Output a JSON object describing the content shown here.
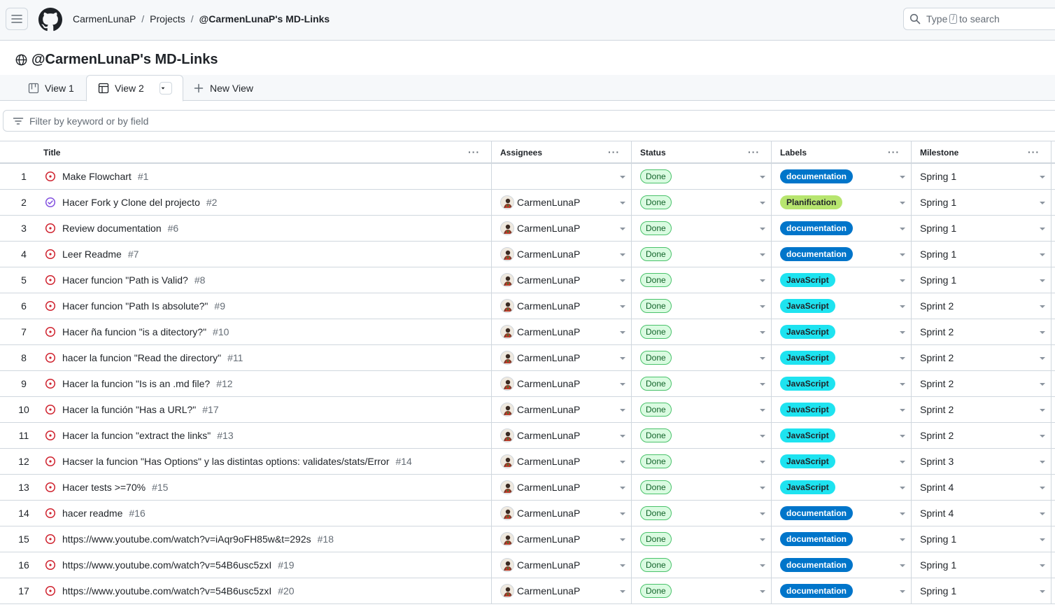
{
  "header": {
    "breadcrumbs": [
      "CarmenLunaP",
      "Projects",
      "@CarmenLunaP's MD-Links"
    ],
    "search_prefix": "Type",
    "search_key": "/",
    "search_suffix": "to search"
  },
  "project": {
    "title": "@CarmenLunaP's MD-Links",
    "tabs": [
      {
        "label": "View 1",
        "icon": "board-icon"
      },
      {
        "label": "View 2",
        "icon": "table-icon",
        "active": true
      },
      {
        "label": "New View",
        "icon": "plus-icon"
      }
    ],
    "filter_placeholder": "Filter by keyword or by field"
  },
  "table": {
    "columns": [
      "Title",
      "Assignees",
      "Status",
      "Labels",
      "Milestone"
    ],
    "rows": [
      {
        "n": "1",
        "title": "Make Flowchart",
        "num": "#1",
        "state": "open",
        "assignee": "",
        "status": "Done",
        "label": "documentation",
        "milestone": "Spring 1"
      },
      {
        "n": "2",
        "title": "Hacer Fork y Clone del projecto",
        "num": "#2",
        "state": "closed",
        "assignee": "CarmenLunaP",
        "status": "Done",
        "label": "Planification",
        "milestone": "Spring 1"
      },
      {
        "n": "3",
        "title": "Review documentation",
        "num": "#6",
        "state": "open",
        "assignee": "CarmenLunaP",
        "status": "Done",
        "label": "documentation",
        "milestone": "Spring 1"
      },
      {
        "n": "4",
        "title": "Leer Readme",
        "num": "#7",
        "state": "open",
        "assignee": "CarmenLunaP",
        "status": "Done",
        "label": "documentation",
        "milestone": "Spring 1"
      },
      {
        "n": "5",
        "title": "Hacer funcion \"Path is Valid?",
        "num": "#8",
        "state": "open",
        "assignee": "CarmenLunaP",
        "status": "Done",
        "label": "JavaScript",
        "milestone": "Spring 1"
      },
      {
        "n": "6",
        "title": "Hacer funcion \"Path Is absolute?\"",
        "num": "#9",
        "state": "open",
        "assignee": "CarmenLunaP",
        "status": "Done",
        "label": "JavaScript",
        "milestone": "Sprint 2"
      },
      {
        "n": "7",
        "title": "Hacer ña funcion \"is a ditectory?\"",
        "num": "#10",
        "state": "open",
        "assignee": "CarmenLunaP",
        "status": "Done",
        "label": "JavaScript",
        "milestone": "Sprint 2"
      },
      {
        "n": "8",
        "title": "hacer la funcion \"Read the directory\"",
        "num": "#11",
        "state": "open",
        "assignee": "CarmenLunaP",
        "status": "Done",
        "label": "JavaScript",
        "milestone": "Sprint 2"
      },
      {
        "n": "9",
        "title": "Hacer la funcion \"Is is an .md file?",
        "num": "#12",
        "state": "open",
        "assignee": "CarmenLunaP",
        "status": "Done",
        "label": "JavaScript",
        "milestone": "Sprint 2"
      },
      {
        "n": "10",
        "title": "Hacer la función \"Has a URL?\"",
        "num": "#17",
        "state": "open",
        "assignee": "CarmenLunaP",
        "status": "Done",
        "label": "JavaScript",
        "milestone": "Sprint 2"
      },
      {
        "n": "11",
        "title": "Hacer la funcion \"extract the links\"",
        "num": "#13",
        "state": "open",
        "assignee": "CarmenLunaP",
        "status": "Done",
        "label": "JavaScript",
        "milestone": "Sprint 2"
      },
      {
        "n": "12",
        "title": "Hacser la funcion \"Has Options\" y las distintas options: validates/stats/Error",
        "num": "#14",
        "state": "open",
        "assignee": "CarmenLunaP",
        "status": "Done",
        "label": "JavaScript",
        "milestone": "Sprint 3"
      },
      {
        "n": "13",
        "title": "Hacer tests >=70%",
        "num": "#15",
        "state": "open",
        "assignee": "CarmenLunaP",
        "status": "Done",
        "label": "JavaScript",
        "milestone": "Sprint 4"
      },
      {
        "n": "14",
        "title": "hacer readme",
        "num": "#16",
        "state": "open",
        "assignee": "CarmenLunaP",
        "status": "Done",
        "label": "documentation",
        "milestone": "Sprint 4"
      },
      {
        "n": "15",
        "title": "https://www.youtube.com/watch?v=iAqr9oFH85w&t=292s",
        "num": "#18",
        "state": "open",
        "assignee": "CarmenLunaP",
        "status": "Done",
        "label": "documentation",
        "milestone": "Spring 1"
      },
      {
        "n": "16",
        "title": "https://www.youtube.com/watch?v=54B6usc5zxI",
        "num": "#19",
        "state": "open",
        "assignee": "CarmenLunaP",
        "status": "Done",
        "label": "documentation",
        "milestone": "Spring 1"
      },
      {
        "n": "17",
        "title": "https://www.youtube.com/watch?v=54B6usc5zxI",
        "num": "#20",
        "state": "open",
        "assignee": "CarmenLunaP",
        "status": "Done",
        "label": "documentation",
        "milestone": "Spring 1"
      }
    ]
  },
  "label_colors": {
    "documentation": {
      "bg": "#0075ca",
      "fg": "#ffffff"
    },
    "Planification": {
      "bg": "#b7e56f",
      "fg": "#1f2328"
    },
    "JavaScript": {
      "bg": "#1ee3f0",
      "fg": "#1f2328"
    }
  },
  "colors": {
    "open_issue": "#cf222e",
    "closed_issue": "#8250df",
    "status_done": "#1a7f37"
  }
}
